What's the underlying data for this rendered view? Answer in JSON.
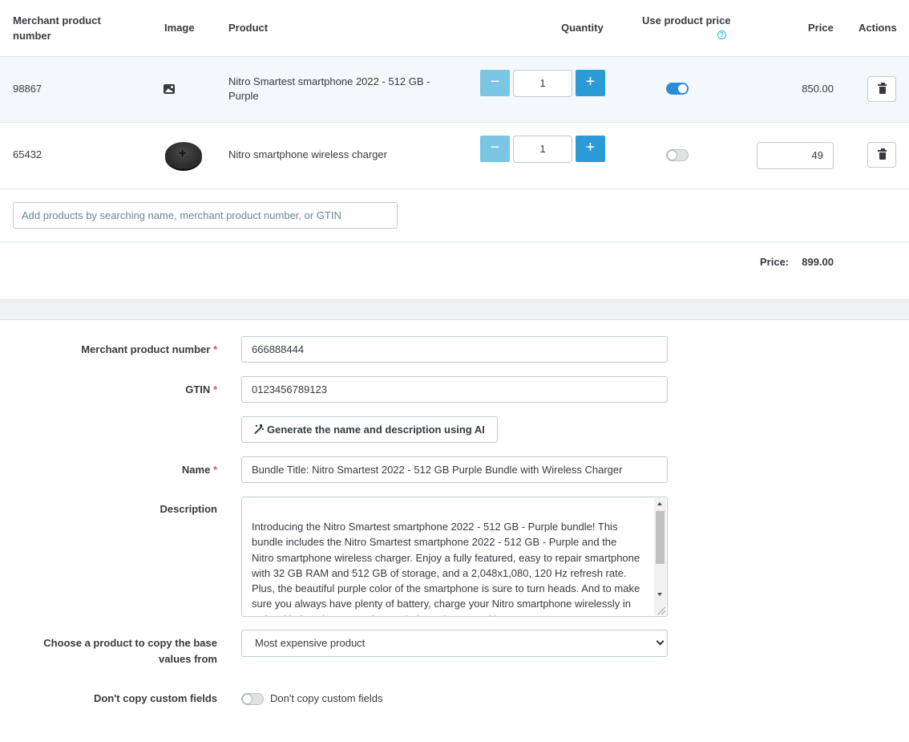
{
  "table": {
    "headers": {
      "merchant_line1": "Merchant product",
      "merchant_line2": "number",
      "image": "Image",
      "product": "Product",
      "quantity": "Quantity",
      "use_price": "Use product price",
      "price": "Price",
      "actions": "Actions"
    },
    "help_icon": "?",
    "rows": [
      {
        "number": "98867",
        "name_line1": "Nitro Smartest smartphone 2022 - 512 GB -",
        "name_line2": "Purple",
        "quantity": "1",
        "use_product_price": true,
        "price": "850.00"
      },
      {
        "number": "65432",
        "name_line1": "Nitro smartphone wireless charger",
        "name_line2": "",
        "quantity": "1",
        "use_product_price": false,
        "price": "49"
      }
    ],
    "minus_label": "−",
    "plus_label": "+",
    "search_placeholder": "Add products by searching name, merchant product number, or GTIN",
    "total_label": "Price:",
    "total_value": "899.00"
  },
  "form": {
    "merchant_label": "Merchant product number",
    "merchant_value": "666888444",
    "gtin_label": "GTIN",
    "gtin_value": "0123456789123",
    "required_mark": "*",
    "ai_button": "Generate the name and description using AI",
    "name_label": "Name",
    "name_value": "Bundle Title: Nitro Smartest 2022 - 512 GB Purple Bundle with Wireless Charger",
    "description_label": "Description",
    "description_value": "Introducing the Nitro Smartest smartphone 2022 - 512 GB - Purple bundle! This bundle includes the Nitro Smartest smartphone 2022 - 512 GB - Purple and the Nitro smartphone wireless charger. Enjoy a fully featured, easy to repair smartphone with 32 GB RAM and 512 GB of storage, and a 2,048x1,080, 120 Hz refresh rate. Plus, the beautiful purple color of the smartphone is sure to turn heads. And to make sure you always have plenty of battery, charge your Nitro smartphone wirelessly in style with the Nitro smartphone wireless charger. With",
    "copy_label_line1": "Choose a product to copy the base",
    "copy_label_line2": "values from",
    "copy_selected": "Most expensive product",
    "custom_fields_label": "Don't copy custom fields",
    "custom_fields_toggle_label": "Don't copy custom fields",
    "custom_fields_on": false
  }
}
